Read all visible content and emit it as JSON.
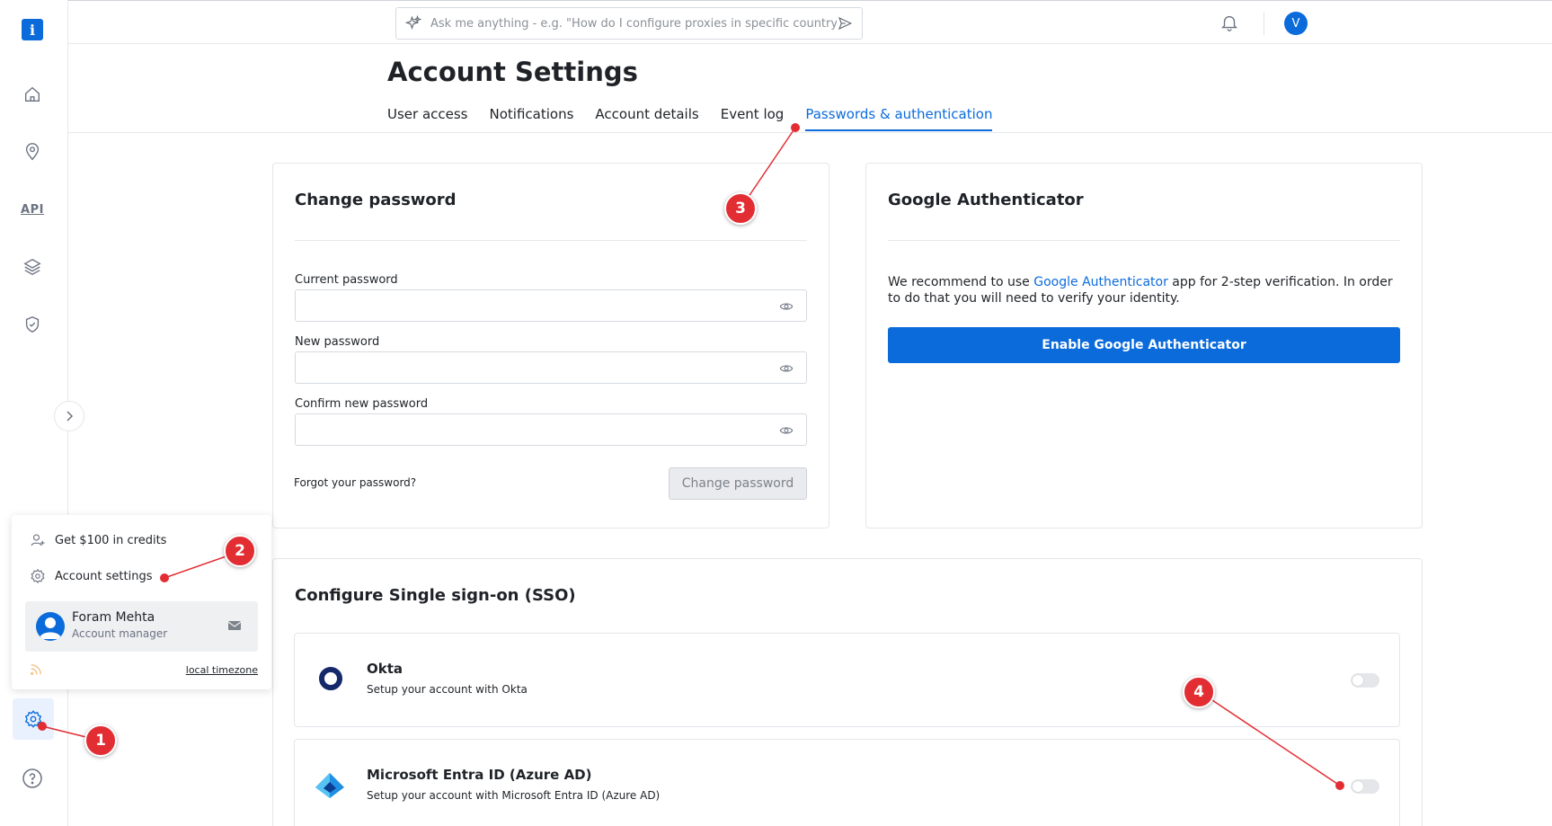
{
  "colors": {
    "accent": "#0b6bdb",
    "annotation": "#e22d33"
  },
  "sidebar": {
    "logo_letter": "i",
    "items": [
      {
        "icon": "home-icon"
      },
      {
        "icon": "location-pin-icon"
      },
      {
        "icon": "api-icon",
        "label": "API"
      },
      {
        "icon": "layers-icon"
      },
      {
        "icon": "shield-check-icon"
      }
    ],
    "bottom": [
      {
        "icon": "gear-icon"
      },
      {
        "icon": "help-icon"
      }
    ]
  },
  "topbar": {
    "ask_placeholder": "Ask me anything - e.g.   \"How do I configure proxies in specific country",
    "avatar_letter": "V"
  },
  "page": {
    "title": "Account Settings",
    "tabs": [
      {
        "label": "User access"
      },
      {
        "label": "Notifications"
      },
      {
        "label": "Account details"
      },
      {
        "label": "Event log"
      },
      {
        "label": "Passwords & authentication",
        "active": true
      }
    ]
  },
  "change_password": {
    "title": "Change password",
    "current_label": "Current password",
    "new_label": "New password",
    "confirm_label": "Confirm new password",
    "forgot": "Forgot your password?",
    "button": "Change password"
  },
  "google_auth": {
    "title": "Google Authenticator",
    "text_before": "We recommend to use ",
    "link": "Google Authenticator",
    "text_after": " app for 2-step verification. In order to do that you will need to verify your identity.",
    "button": "Enable Google Authenticator"
  },
  "sso": {
    "title": "Configure Single sign-on (SSO)",
    "providers": [
      {
        "name": "Okta",
        "desc": "Setup your account with Okta",
        "enabled": false
      },
      {
        "name": "Microsoft Entra ID (Azure AD)",
        "desc": "Setup your account with Microsoft Entra ID (Azure AD)",
        "enabled": false
      }
    ]
  },
  "popup_menu": {
    "credits": "Get $100 in credits",
    "settings": "Account settings",
    "manager_name": "Foram Mehta",
    "manager_role": "Account manager",
    "timezone": "local timezone"
  },
  "annotations": [
    "1",
    "2",
    "3",
    "4"
  ]
}
